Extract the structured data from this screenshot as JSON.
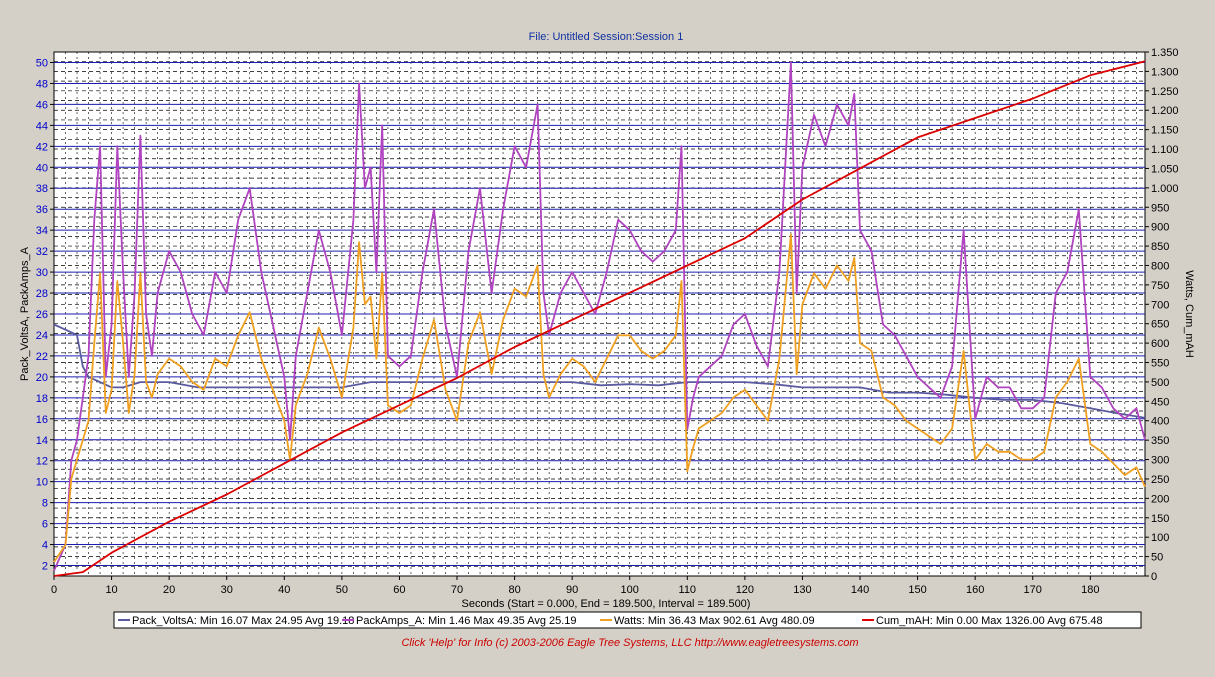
{
  "chart_data": {
    "type": "line",
    "title": "File: Untitled   Session:Session 1",
    "xlabel": "Seconds (Start = 0.000,  End = 189.500,  Interval = 189.500)",
    "ylabel_left": "Pack_VoltsA, PackAmps_A",
    "ylabel_right": "Watts, Cum_mAH",
    "xlim": [
      0,
      189.5
    ],
    "ylim_left": [
      1,
      51
    ],
    "ylim_right": [
      0,
      1350
    ],
    "x_ticks": [
      0,
      10,
      20,
      30,
      40,
      50,
      60,
      70,
      80,
      90,
      100,
      110,
      120,
      130,
      140,
      150,
      160,
      170,
      180
    ],
    "y_ticks_left": [
      2,
      4,
      6,
      8,
      10,
      12,
      14,
      16,
      18,
      20,
      22,
      24,
      26,
      28,
      30,
      32,
      34,
      36,
      38,
      40,
      42,
      44,
      46,
      48,
      50
    ],
    "y_ticks_right": [
      "0",
      "50",
      "100",
      "150",
      "200",
      "250",
      "300",
      "350",
      "400",
      "450",
      "500",
      "550",
      "600",
      "650",
      "700",
      "750",
      "800",
      "850",
      "900",
      "950",
      "1.000",
      "1.050",
      "1.100",
      "1.150",
      "1.200",
      "1.250",
      "1.300",
      "1.350"
    ],
    "grid": true,
    "legend_position": "bottom",
    "series": [
      {
        "name": "Pack_VoltsA",
        "axis": "left",
        "color": "#5a5aa0",
        "stats": "Min 16.07    Max 24.95    Avg 19.18",
        "x": [
          0,
          2,
          4,
          5,
          6,
          8,
          10,
          12,
          15,
          20,
          25,
          30,
          35,
          40,
          45,
          50,
          55,
          60,
          65,
          70,
          75,
          80,
          85,
          90,
          95,
          100,
          105,
          110,
          115,
          120,
          125,
          130,
          135,
          140,
          145,
          150,
          155,
          160,
          165,
          170,
          175,
          180,
          185,
          189.5
        ],
        "y": [
          25,
          24.5,
          24,
          21,
          20,
          19.5,
          19,
          19,
          19.5,
          19.5,
          19,
          19,
          19,
          19,
          19,
          19,
          19.5,
          19.5,
          19.5,
          19.5,
          19.5,
          19.5,
          19.5,
          19.5,
          19.2,
          19.3,
          19.2,
          19.5,
          19.5,
          19.5,
          19.3,
          19,
          19,
          19,
          18.5,
          18.5,
          18.3,
          18,
          17.8,
          17.8,
          17.5,
          17,
          16.5,
          16.1
        ]
      },
      {
        "name": "PackAmps_A",
        "axis": "left",
        "color": "#b044c0",
        "stats": "Min 1.46    Max 49.35    Avg 25.19",
        "x": [
          0,
          2,
          3,
          4,
          5,
          6,
          7,
          8,
          9,
          10,
          11,
          12,
          13,
          14,
          15,
          16,
          17,
          18,
          20,
          22,
          24,
          26,
          28,
          30,
          32,
          34,
          36,
          38,
          40,
          41,
          42,
          44,
          46,
          48,
          50,
          52,
          53,
          54,
          55,
          56,
          57,
          58,
          60,
          62,
          64,
          66,
          68,
          70,
          72,
          74,
          76,
          78,
          80,
          82,
          84,
          85,
          86,
          88,
          90,
          92,
          94,
          96,
          98,
          100,
          102,
          104,
          106,
          108,
          109,
          110,
          111,
          112,
          114,
          116,
          118,
          120,
          122,
          124,
          126,
          128,
          129,
          130,
          132,
          134,
          136,
          138,
          139,
          140,
          142,
          144,
          146,
          148,
          150,
          152,
          154,
          156,
          158,
          160,
          162,
          164,
          166,
          168,
          170,
          172,
          174,
          176,
          178,
          180,
          182,
          184,
          186,
          188,
          189.5
        ],
        "y": [
          1.5,
          4,
          12,
          14,
          18,
          22,
          35,
          42,
          20,
          25,
          42,
          30,
          20,
          28,
          43,
          26,
          22,
          28,
          32,
          30,
          26,
          24,
          30,
          28,
          35,
          38,
          30,
          25,
          20,
          14,
          22,
          28,
          34,
          30,
          24,
          35,
          48,
          38,
          40,
          30,
          44,
          22,
          21,
          22,
          30,
          36,
          25,
          20,
          32,
          38,
          28,
          36,
          42,
          40,
          46,
          28,
          24,
          28,
          30,
          28,
          26,
          30,
          35,
          34,
          32,
          31,
          32,
          34,
          42,
          15,
          18,
          20,
          21,
          22,
          25,
          26,
          23,
          21,
          30,
          50,
          28,
          40,
          45,
          42,
          46,
          44,
          47,
          34,
          32,
          25,
          24,
          22,
          20,
          19,
          18,
          21,
          34,
          16,
          20,
          19,
          19,
          17,
          17,
          18,
          28,
          30,
          36,
          20,
          19,
          17,
          16,
          17,
          14
        ]
      },
      {
        "name": "Watts",
        "axis": "right",
        "color": "#f0a020",
        "stats": "Min 36.43    Max 902.61    Avg 480.09",
        "x": [
          0,
          2,
          3,
          4,
          5,
          6,
          7,
          8,
          9,
          10,
          11,
          12,
          13,
          14,
          15,
          16,
          17,
          18,
          20,
          22,
          24,
          26,
          28,
          30,
          32,
          34,
          36,
          38,
          40,
          41,
          42,
          44,
          46,
          48,
          50,
          52,
          53,
          54,
          55,
          56,
          57,
          58,
          60,
          62,
          64,
          66,
          68,
          70,
          72,
          74,
          76,
          78,
          80,
          82,
          84,
          85,
          86,
          88,
          90,
          92,
          94,
          96,
          98,
          100,
          102,
          104,
          106,
          108,
          109,
          110,
          111,
          112,
          114,
          116,
          118,
          120,
          122,
          124,
          126,
          128,
          129,
          130,
          132,
          134,
          136,
          138,
          139,
          140,
          142,
          144,
          146,
          148,
          150,
          152,
          154,
          156,
          158,
          160,
          162,
          164,
          166,
          168,
          170,
          172,
          174,
          176,
          178,
          180,
          182,
          184,
          186,
          188,
          189.5
        ],
        "y": [
          36,
          80,
          250,
          300,
          350,
          400,
          600,
          780,
          420,
          480,
          760,
          600,
          420,
          520,
          780,
          500,
          460,
          520,
          560,
          540,
          500,
          480,
          560,
          540,
          620,
          680,
          560,
          480,
          400,
          300,
          440,
          520,
          640,
          560,
          460,
          640,
          860,
          700,
          720,
          560,
          780,
          440,
          420,
          440,
          560,
          660,
          480,
          400,
          600,
          680,
          520,
          660,
          740,
          720,
          800,
          520,
          460,
          520,
          560,
          540,
          500,
          560,
          620,
          620,
          580,
          560,
          580,
          620,
          760,
          270,
          330,
          380,
          400,
          420,
          460,
          480,
          440,
          400,
          560,
          880,
          520,
          700,
          780,
          740,
          800,
          760,
          820,
          600,
          580,
          460,
          440,
          400,
          380,
          360,
          340,
          380,
          580,
          300,
          340,
          320,
          320,
          300,
          300,
          320,
          460,
          500,
          560,
          340,
          320,
          290,
          260,
          280,
          230
        ]
      },
      {
        "name": "Cum_mAH",
        "axis": "right",
        "color": "#dd0000",
        "stats": "Min 0.00    Max 1326.00    Avg 675.48",
        "x": [
          0,
          5,
          10,
          20,
          30,
          40,
          50,
          60,
          70,
          80,
          90,
          100,
          110,
          120,
          130,
          140,
          150,
          160,
          170,
          180,
          189.5
        ],
        "y": [
          0,
          10,
          60,
          140,
          210,
          290,
          370,
          440,
          510,
          590,
          660,
          730,
          800,
          870,
          970,
          1050,
          1130,
          1180,
          1230,
          1290,
          1326
        ]
      }
    ]
  },
  "footer": {
    "text": "Click 'Help' for Info  (c) 2003-2006 Eagle Tree Systems, LLC      http://www.eagletreesystems.com"
  },
  "colors": {
    "plot_background": "#ffffff",
    "major_grid": "#1c1cb0",
    "minor_grid": "#000000",
    "frame_background": "#d4d0c8"
  }
}
